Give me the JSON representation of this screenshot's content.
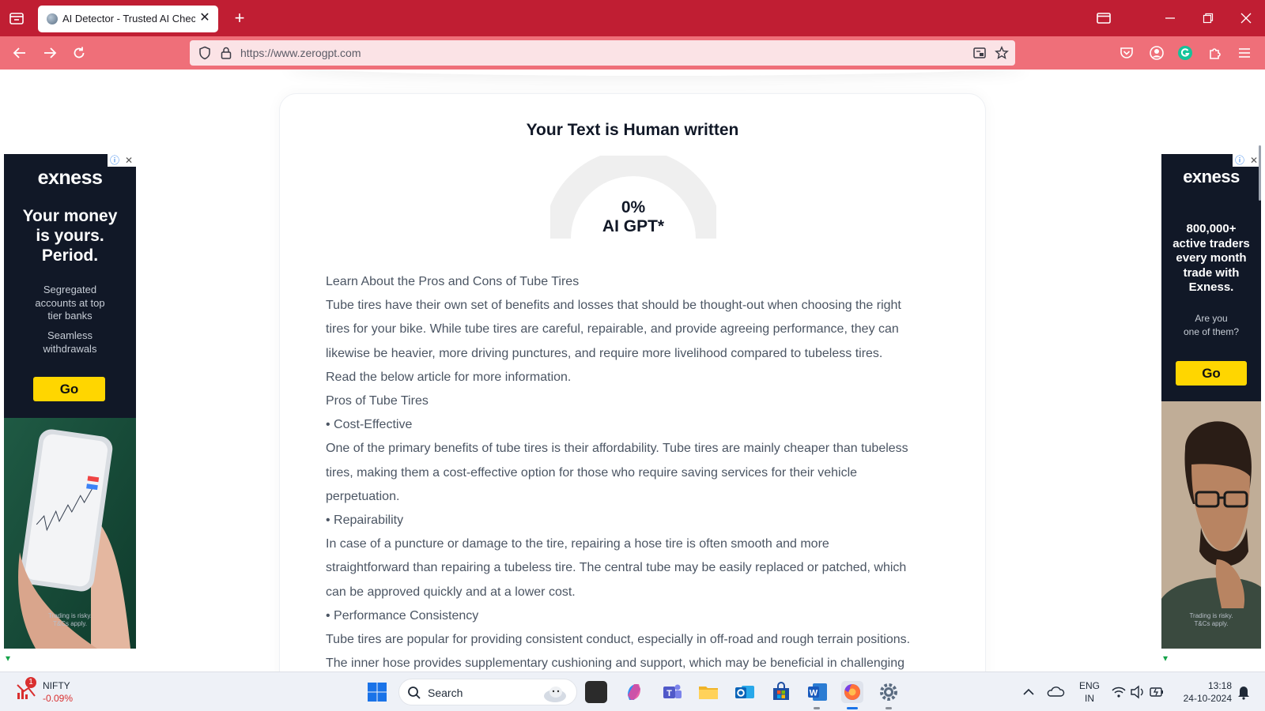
{
  "browser": {
    "tab_title": "AI Detector - Trusted AI Checker",
    "tab_close": "✕",
    "new_tab": "+",
    "url": "https://www.zerogpt.com"
  },
  "result": {
    "title": "Your Text is Human written",
    "percent": "0%",
    "label": "AI GPT*",
    "ai_fraction": 0
  },
  "text_lines": [
    "Learn About the Pros and Cons of Tube Tires",
    "Tube tires have their own set of benefits and losses that should be thought-out when choosing the right",
    "tires for your bike. While tube tires are careful, repairable, and provide agreeing performance, they can",
    "likewise be heavier, more driving punctures, and require more livelihood compared to tubeless tires.",
    "Read the below article for more information.",
    "Pros of Tube Tires",
    "• Cost-Effective",
    "One of the primary benefits of tube tires is their affordability. Tube tires are mainly cheaper than tubeless",
    "tires, making them a cost-effective option for those who require saving services for their vehicle",
    "perpetuation.",
    "• Repairability",
    "In case of a puncture or damage to the tire, repairing a hose tire is often smooth and more",
    "straightforward than repairing a tubeless tire. The central tube may be easily replaced or patched, which",
    "can be approved quickly and at a lower cost.",
    "• Performance Consistency",
    "Tube tires are popular for providing consistent conduct, especially in off-road and rough terrain positions.",
    "The inner hose provides supplementary cushioning and support, which may be beneficial in challenging"
  ],
  "ad_left": {
    "brand": "exness",
    "headline": [
      "Your money",
      "is yours.",
      "Period."
    ],
    "sub1": [
      "Segregated",
      "accounts at top",
      "tier banks"
    ],
    "sub2": [
      "Seamless",
      "withdrawals"
    ],
    "cta": "Go",
    "disclaimer": [
      "Trading is risky.",
      "T&Cs apply."
    ]
  },
  "ad_right": {
    "brand": "exness",
    "headline": [
      "800,000+",
      "active traders",
      "every month",
      "trade with",
      "Exness."
    ],
    "sub": [
      "Are you",
      "one of them?"
    ],
    "cta": "Go",
    "disclaimer": [
      "Trading is risky.",
      "T&Cs apply."
    ]
  },
  "taskbar": {
    "stock_name": "NIFTY",
    "stock_change": "-0.09%",
    "stock_badge": "1",
    "search_placeholder": "Search",
    "lang_top": "ENG",
    "lang_bottom": "IN",
    "time": "13:18",
    "date": "24-10-2024"
  },
  "colors": {
    "tabbar": "#c01e33",
    "navbar": "#ef6f79",
    "ad_bg": "#111827",
    "cta": "#ffd600"
  }
}
